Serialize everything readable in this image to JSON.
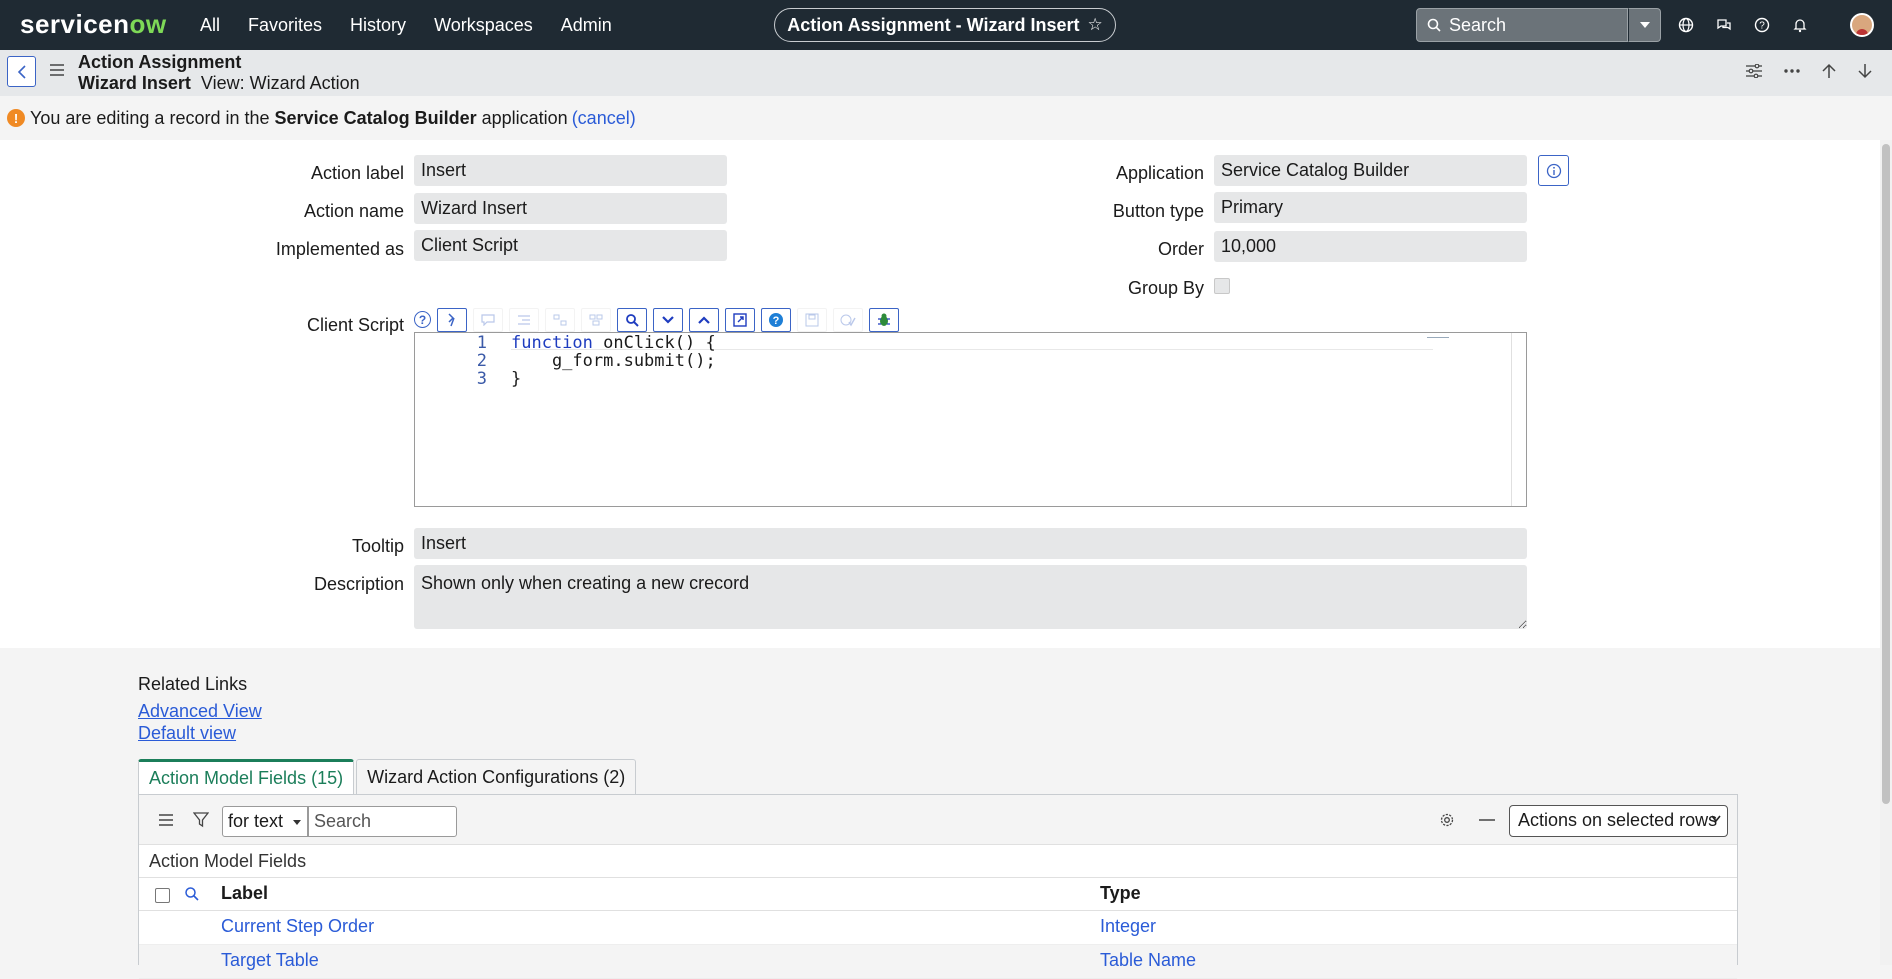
{
  "nav": {
    "logo": "servicenow",
    "menu": [
      "All",
      "Favorites",
      "History",
      "Workspaces",
      "Admin"
    ],
    "record_title": "Action Assignment - Wizard Insert",
    "search_placeholder": "Search"
  },
  "header": {
    "title": "Action Assignment",
    "record_name": "Wizard Insert",
    "view_label": "View: Wizard Action"
  },
  "message": {
    "prefix": "You are editing a record in the",
    "application": "Service Catalog Builder",
    "suffix": "application",
    "cancel": "(cancel)"
  },
  "form": {
    "action_label": {
      "label": "Action label",
      "value": "Insert"
    },
    "action_name": {
      "label": "Action name",
      "value": "Wizard Insert"
    },
    "implemented_as": {
      "label": "Implemented as",
      "value": "Client Script"
    },
    "application": {
      "label": "Application",
      "value": "Service Catalog Builder"
    },
    "button_type": {
      "label": "Button type",
      "value": "Primary"
    },
    "order": {
      "label": "Order",
      "value": "10,000"
    },
    "group_by": {
      "label": "Group By",
      "checked": false
    },
    "client_script": {
      "label": "Client Script",
      "line_numbers": [
        "1",
        "2",
        "3"
      ],
      "lines": {
        "l1_kw": "function",
        "l1_rest": " onClick() {",
        "l2": "    g_form.submit();",
        "l3": "}"
      }
    },
    "tooltip": {
      "label": "Tooltip",
      "value": "Insert"
    },
    "description": {
      "label": "Description",
      "value": "Shown only when creating a new crecord"
    }
  },
  "related_links": {
    "title": "Related Links",
    "links": [
      "Advanced View",
      "Default view"
    ]
  },
  "tabs": [
    "Action Model Fields (15)",
    "Wizard Action Configurations (2)"
  ],
  "list": {
    "search_field": "for text",
    "search_placeholder": "Search",
    "actions_select": "Actions on selected rows",
    "name": "Action Model Fields",
    "columns": [
      "Label",
      "Type"
    ],
    "rows": [
      {
        "label": "Current Step Order",
        "type": "Integer"
      },
      {
        "label": "Target Table",
        "type": "Table Name"
      }
    ]
  },
  "colors": {
    "navbar": "#1f2a33",
    "accent_green": "#1b7e5a",
    "link_blue": "#2a5bd7",
    "warning": "#f08a24"
  }
}
